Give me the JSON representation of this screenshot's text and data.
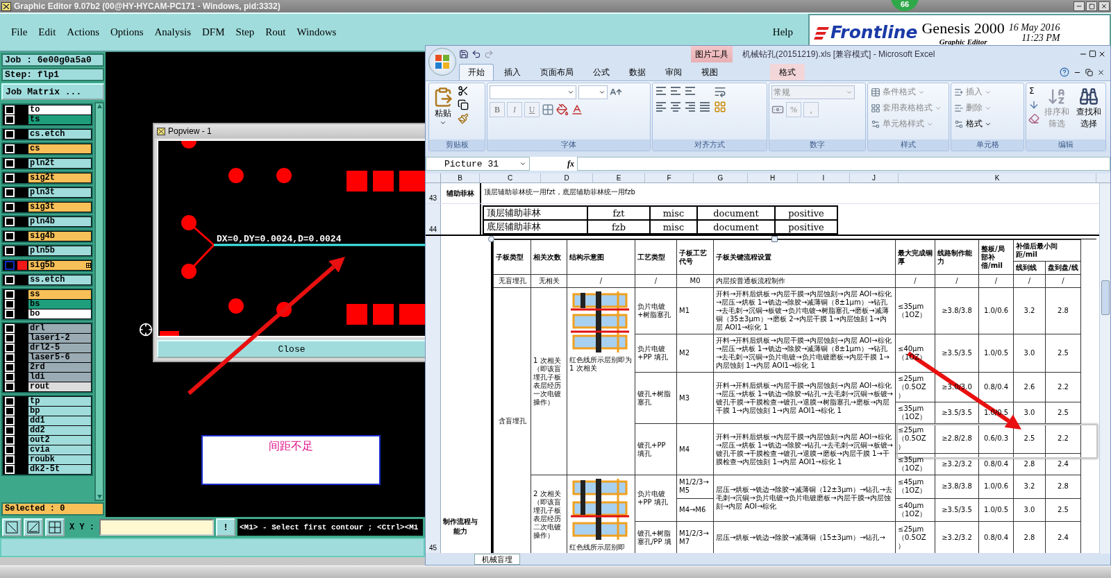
{
  "genesis": {
    "title": "Graphic Editor 9.07b2 (00@HY-HYCAM-PC171 - Windows, pid:3332)",
    "badge": "66",
    "menu": [
      "File",
      "Edit",
      "Actions",
      "Options",
      "Analysis",
      "DFM",
      "Step",
      "Rout",
      "Windows"
    ],
    "help": "Help",
    "brand": {
      "logo": "Frontline",
      "product": "Genesis 2000",
      "subtitle": "Graphic Editor",
      "date": "16 May 2016",
      "time": "11:23 PM"
    },
    "job": "Job : 6e00g0a5a0",
    "step": "Step: flp1",
    "job_matrix": "Job Matrix ...",
    "layer_groups": [
      {
        "layers": [
          {
            "name": "to",
            "color": "#ffffff",
            "selected": false,
            "checked": false
          },
          {
            "name": "ts",
            "color": "#1e9e7c",
            "selected": false,
            "checked": false
          }
        ]
      },
      {
        "layers": [
          {
            "name": "cs.etch",
            "color": "#a0dcdc",
            "selected": false,
            "checked": false
          }
        ]
      },
      {
        "layers": [
          {
            "name": "cs",
            "color": "#f8c058",
            "selected": false,
            "checked": false
          }
        ]
      },
      {
        "layers": [
          {
            "name": "pln2t",
            "color": "#a0dcdc",
            "selected": false,
            "checked": false
          }
        ]
      },
      {
        "layers": [
          {
            "name": "sig2t",
            "color": "#f8c058",
            "selected": false,
            "checked": false
          }
        ]
      },
      {
        "layers": [
          {
            "name": "pln3t",
            "color": "#a0dcdc",
            "selected": false,
            "checked": false
          }
        ]
      },
      {
        "layers": [
          {
            "name": "sig3t",
            "color": "#f8c058",
            "selected": false,
            "checked": false
          }
        ]
      },
      {
        "layers": [
          {
            "name": "pln4b",
            "color": "#a0dcdc",
            "selected": false,
            "checked": false
          }
        ]
      },
      {
        "layers": [
          {
            "name": "sig4b",
            "color": "#f8c058",
            "selected": false,
            "checked": false
          }
        ]
      },
      {
        "layers": [
          {
            "name": "pln5b",
            "color": "#a0dcdc",
            "selected": false,
            "checked": false
          }
        ]
      },
      {
        "layers": [
          {
            "name": "sig5b",
            "color": "#f8c058",
            "selected": true,
            "checked": false
          }
        ]
      },
      {
        "layers": [
          {
            "name": "ss.etch",
            "color": "#a0dcdc",
            "selected": false,
            "checked": false
          }
        ]
      },
      {
        "layers": [
          {
            "name": "ss",
            "color": "#f8c058",
            "selected": false,
            "checked": false
          },
          {
            "name": "bs",
            "color": "#1e9e7c",
            "selected": false,
            "checked": false
          },
          {
            "name": "bo",
            "color": "#ffffff",
            "selected": false,
            "checked": false
          }
        ]
      },
      {
        "layers": [
          {
            "name": "drl",
            "color": "#9aabb4",
            "selected": false,
            "checked": false
          },
          {
            "name": "laser1-2",
            "color": "#9aabb4",
            "selected": false,
            "checked": false
          },
          {
            "name": "drl2-5",
            "color": "#9aabb4",
            "selected": false,
            "checked": false
          },
          {
            "name": "laser5-6",
            "color": "#9aabb4",
            "selected": false,
            "checked": false
          },
          {
            "name": "2rd",
            "color": "#9aabb4",
            "selected": false,
            "checked": false
          },
          {
            "name": "ldi",
            "color": "#9aabb4",
            "selected": false,
            "checked": false
          },
          {
            "name": "rout",
            "color": "#dcdcdc",
            "selected": false,
            "checked": false
          }
        ]
      },
      {
        "layers": [
          {
            "name": "tp",
            "color": "#a0dcdc",
            "selected": false,
            "checked": false
          },
          {
            "name": "bp",
            "color": "#a0dcdc",
            "selected": false,
            "checked": false
          },
          {
            "name": "dd1",
            "color": "#a0dcdc",
            "selected": false,
            "checked": false
          },
          {
            "name": "dd2",
            "color": "#a0dcdc",
            "selected": false,
            "checked": false
          },
          {
            "name": "out2",
            "color": "#a0dcdc",
            "selected": false,
            "checked": false
          },
          {
            "name": "cvia",
            "color": "#a0dcdc",
            "selected": false,
            "checked": false
          },
          {
            "name": "roubk",
            "color": "#a0dcdc",
            "selected": false,
            "checked": false
          },
          {
            "name": "dk2-5t",
            "color": "#a0dcdc",
            "selected": false,
            "checked": false
          }
        ]
      }
    ],
    "selected_count": "Selected : 0",
    "popview": {
      "title": "Popview - 1",
      "measurement": "DX=0,DY=0.0024,D=0.0024",
      "close": "Close"
    },
    "note": "间距不足",
    "xy_label": "X Y :",
    "bang": "!",
    "prompt": "<M1> - Select first contour ; <Ctrl><M1"
  },
  "excel": {
    "title": "机械钻孔(20151219).xls  [兼容模式] - Microsoft Excel",
    "context_title": "图片工具",
    "tabs": [
      {
        "label": "开始",
        "selected": true,
        "contextual": false
      },
      {
        "label": "插入",
        "selected": false,
        "contextual": false
      },
      {
        "label": "页面布局",
        "selected": false,
        "contextual": false
      },
      {
        "label": "公式",
        "selected": false,
        "contextual": false
      },
      {
        "label": "数据",
        "selected": false,
        "contextual": false
      },
      {
        "label": "审阅",
        "selected": false,
        "contextual": false
      },
      {
        "label": "视图",
        "selected": false,
        "contextual": false
      },
      {
        "label": "格式",
        "selected": false,
        "contextual": true
      }
    ],
    "ribbon": [
      {
        "kind": "clipboard",
        "label": "剪贴板",
        "items": [
          {
            "label": "粘贴",
            "disabled": false
          }
        ]
      },
      {
        "kind": "font",
        "label": "字体",
        "items": [
          {
            "label": "B",
            "disabled": true
          },
          {
            "label": "I",
            "disabled": true
          },
          {
            "label": "U",
            "disabled": true
          }
        ]
      },
      {
        "kind": "align",
        "label": "对齐方式"
      },
      {
        "kind": "number",
        "label": "数字",
        "items": [
          {
            "label": "常规",
            "disabled": true
          },
          {
            "label": "%",
            "disabled": true
          },
          {
            "label": ",",
            "disabled": true
          }
        ]
      },
      {
        "kind": "list",
        "label": "样式",
        "items": [
          {
            "label": "条件格式",
            "disabled": true
          },
          {
            "label": "套用表格格式",
            "disabled": true
          },
          {
            "label": "单元格样式",
            "disabled": true
          }
        ]
      },
      {
        "kind": "list",
        "label": "单元格",
        "items": [
          {
            "label": "插入",
            "disabled": true
          },
          {
            "label": "删除",
            "disabled": true
          },
          {
            "label": "格式",
            "disabled": false
          }
        ]
      },
      {
        "kind": "editing",
        "label": "编辑",
        "items": [
          {
            "label": "Σ",
            "disabled": false
          },
          {
            "label": "排序和筛选",
            "disabled": true
          },
          {
            "label": "查找和选择",
            "disabled": false
          }
        ]
      }
    ],
    "name_box": "Picture 31",
    "formula_label": "fx",
    "columns": [
      "B",
      "C",
      "D",
      "E",
      "F",
      "G",
      "H",
      "I",
      "J",
      "K"
    ],
    "row43": {
      "number": "43",
      "label": "辅助菲林",
      "note": "顶层辅助菲林统一用fzt，底层辅助菲林统一用fzb"
    },
    "row44": {
      "number": "44",
      "films": [
        [
          "顶层辅助菲林",
          "fzt",
          "misc",
          "document",
          "positive"
        ],
        [
          "底层辅助菲林",
          "fzb",
          "misc",
          "document",
          "positive"
        ]
      ]
    },
    "row45": {
      "number": "45",
      "label": "制作流程与能力",
      "table": {
        "headers": [
          "子板类型",
          "相关次数",
          "结构示意图",
          "工艺类型",
          "子板工艺代号",
          "子板关键流程设置",
          "最大完成铜厚",
          "线路制作能力",
          "整板/局部补偿/mil"
        ],
        "spacing_header": "补偿后最小间距/mil",
        "spacing_subheaders": [
          "线到线",
          "盘到盘/线"
        ],
        "plain_row": [
          "无盲埋孔",
          "无相关",
          "/",
          "/",
          "M0",
          "内层按普通板流程制作",
          "/",
          "/",
          "/",
          "/",
          "/"
        ],
        "blind_type": "含盲埋孔",
        "relations": [
          {
            "label": "1 次相关（即该盲埋孔子板表层经历一次电镀操作）",
            "caption": "红色线所示层别即为 1 次相关",
            "processes": [
              {
                "process_type": "负片电镀+树脂塞孔",
                "code": "M1",
                "flow": "开料→开料后烘板→内层干膜→内层蚀刻→内层 AOI→棕化→层压→烘板 1→铣边→除胶→减薄铜（8±1μm）→钻孔→去毛刺→沉铜→板镀→负片电镀→树脂塞孔→磨板→减薄铜（35±3μm）→磨板 2→内层干膜 1→内层蚀刻 1→内层 AOI1→棕化 1",
                "subrows": [
                  {
                    "caps": [
                      "≤35μm（1OZ）",
                      "≥3.8/3.8",
                      "1.0/0.6",
                      "3.2",
                      "2.8"
                    ]
                  }
                ]
              },
              {
                "process_type": "负片电镀+PP 填孔",
                "code": "M2",
                "flow": "开料→开料后烘板→内层干膜→内层蚀刻→内层 AOI→棕化→层压→烘板 1→铣边→除胶→减薄铜（8±1μm）→钻孔→去毛刺→沉铜→负片电镀→负片电镀磨板→内层干膜 1→内层蚀刻 1→内层 AOI1→棕化 1",
                "subrows": [
                  {
                    "caps": [
                      "≤40μm（1OZ）",
                      "≥3.5/3.5",
                      "1.0/0.5",
                      "3.0",
                      "2.5"
                    ]
                  }
                ]
              },
              {
                "process_type": "镀孔+树脂塞孔",
                "code": "M3",
                "flow": "开料→开料后烘板→内层干膜→内层蚀刻→内层 AOI→棕化→层压→烘板 1→铣边→除胶→钻孔→去毛刺→沉铜→板镀→镀孔干膜→干膜检查→镀孔→退膜→树脂塞孔→磨板→内层干膜 1→内层蚀刻 1→内层 AOI1→棕化 1",
                "subrows": [
                  {
                    "caps": [
                      "≤25μm（0.5OZ）",
                      "≥3.0/3.0",
                      "0.8/0.4",
                      "2.6",
                      "2.2"
                    ]
                  },
                  {
                    "caps": [
                      "≤35μm（1OZ）",
                      "≥3.5/3.5",
                      "1.0/0.5",
                      "3.0",
                      "2.5"
                    ]
                  }
                ]
              },
              {
                "process_type": "镀孔+PP 填孔",
                "code": "M4",
                "flow": "开料→开料后烘板→内层干膜→内层蚀刻→内层 AOI→棕化→层压→烘板 1→铣边→除胶→钻孔→去毛刺→沉铜→板镀→镀孔干膜→干膜检查→镀孔→退膜→磨板→内层干膜 1→干膜检查→内层蚀刻 1→内层 AOI1→棕化 1",
                "subrows": [
                  {
                    "caps": [
                      "≤25μm（0.5OZ）",
                      "≥2.8/2.8",
                      "0.6/0.3",
                      "2.5",
                      "2.2"
                    ]
                  },
                  {
                    "caps": [
                      "≤35μm（1OZ）",
                      "≥3.2/3.2",
                      "0.8/0.4",
                      "2.8",
                      "2.4"
                    ]
                  }
                ]
              }
            ]
          },
          {
            "label": "2 次相关（即该盲埋孔子板表层经历二次电镀操作）",
            "caption": "红色线所示层别即",
            "processes": [
              {
                "process_type": "负片电镀+PP 填孔",
                "flow": "层压→烘板→铣边→除胶→减薄铜（12±3μm）→钻孔→去毛刺→沉铜→负片电镀→负片电镀磨板→内层干膜→内层蚀刻→内层 AOI→棕化",
                "subrows": [
                  {
                    "code": "M1/2/3→M5",
                    "caps": [
                      "≤45μm（1OZ）",
                      "≥3.8/3.8",
                      "1.0/0.6",
                      "3.2",
                      "2.8"
                    ]
                  },
                  {
                    "code": "M4→M6",
                    "caps": [
                      "≤40μm（1OZ）",
                      "≥3.5/3.5",
                      "1.0/0.5",
                      "3.0",
                      "2.5"
                    ]
                  }
                ]
              },
              {
                "process_type": "镀孔+树脂塞孔/PP 填",
                "flow": "层压→烘板→铣边→除胶→减薄铜（15±3μm）→钻孔→",
                "subrows": [
                  {
                    "code": "M1/2/3→M7",
                    "caps": [
                      "≤25μm（0.5OZ）",
                      "≥3.2/3.2",
                      "0.8/0.4",
                      "2.8",
                      "2.4"
                    ]
                  }
                ]
              }
            ]
          }
        ]
      }
    },
    "sheet_tab": "机械盲埋"
  }
}
